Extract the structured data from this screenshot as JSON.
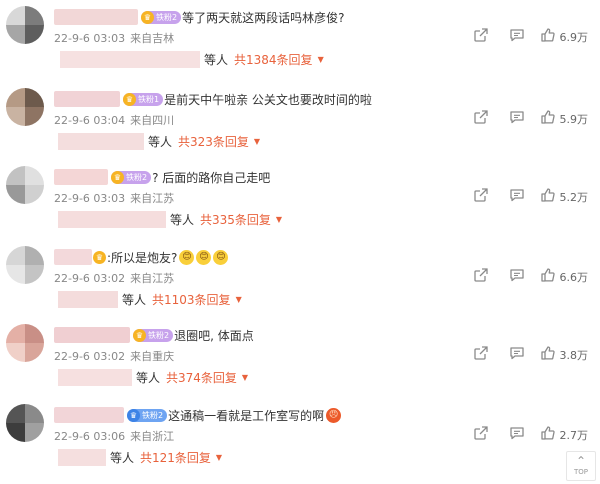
{
  "comments": [
    {
      "badge": {
        "text": "铁粉2",
        "style": "gold"
      },
      "text": "等了两天就这两段话吗林彦俊?",
      "emojis": [],
      "date": "22-9-6 03:03",
      "location": "来自吉林",
      "likes": "6.9万",
      "reply_people": "等人",
      "reply_total": "共1384条回复",
      "avatar_colors": [
        "#d8d8d8",
        "#7c7c7c",
        "#a6a6a6",
        "#5e5e5e"
      ],
      "name_blur_color": "#f2d7d7",
      "reply_blur_color": "#f6e1e1"
    },
    {
      "badge": {
        "text": "铁粉1",
        "style": "gold"
      },
      "text": "是前天中午啦亲 公关文也要改时间的啦",
      "emojis": [],
      "date": "22-9-6 03:04",
      "location": "来自四川",
      "likes": "5.9万",
      "reply_people": "等人",
      "reply_total": "共323条回复",
      "avatar_colors": [
        "#b59a85",
        "#6d5a4c",
        "#c9b3a2",
        "#8e7463"
      ],
      "name_blur_color": "#f1d3d6",
      "reply_blur_color": "#f4dede"
    },
    {
      "badge": {
        "text": "铁粉2",
        "style": "gold"
      },
      "text": "? 后面的路你自己走吧",
      "emojis": [],
      "date": "22-9-6 03:03",
      "location": "来自江苏",
      "likes": "5.2万",
      "reply_people": "等人",
      "reply_total": "共335条回复",
      "avatar_colors": [
        "#c2c2c2",
        "#e0e0e0",
        "#999999",
        "#d0d0d0"
      ],
      "name_blur_color": "#f4d6d6",
      "reply_blur_color": "#f5dddd"
    },
    {
      "badge": {
        "text": "",
        "style": "bare"
      },
      "text": ":所以是炮友?",
      "emojis": [
        "😊",
        "😊",
        "😊"
      ],
      "date": "22-9-6 03:02",
      "location": "来自江苏",
      "likes": "6.6万",
      "reply_people": "等人",
      "reply_total": "共1103条回复",
      "avatar_colors": [
        "#d6d6d6",
        "#b0b0b0",
        "#e6e6e6",
        "#c4c4c4"
      ],
      "name_blur_color": "#f3d9db",
      "reply_blur_color": "#f4dcdc"
    },
    {
      "badge": {
        "text": "铁粉2",
        "style": "gold"
      },
      "text": "退圈吧, 体面点",
      "emojis": [],
      "date": "22-9-6 03:02",
      "location": "来自重庆",
      "likes": "3.8万",
      "reply_people": "等人",
      "reply_total": "共374条回复",
      "avatar_colors": [
        "#e4b0a6",
        "#c98f86",
        "#f0d0c8",
        "#d9a59a"
      ],
      "name_blur_color": "#f0cfd2",
      "reply_blur_color": "#f6e0e0"
    },
    {
      "badge": {
        "text": "铁粉2",
        "style": "blue"
      },
      "text": "这通稿一看就是工作室写的啊",
      "emojis": [
        "😠"
      ],
      "date": "22-9-6 03:06",
      "location": "来自浙江",
      "likes": "2.7万",
      "reply_people": "等人",
      "reply_total": "共121条回复",
      "avatar_colors": [
        "#555555",
        "#8a8a8a",
        "#3d3d3d",
        "#a0a0a0"
      ],
      "name_blur_color": "#f2d5d8",
      "reply_blur_color": "#f5dfdf"
    }
  ],
  "back_to_top": {
    "label": "TOP"
  },
  "icons": {
    "share": "share-icon",
    "comment": "comment-icon",
    "like": "like-icon",
    "caret": "caret-down-icon",
    "top": "arrow-up-icon"
  },
  "colors": {
    "accent": "#e8623c",
    "meta": "#888888",
    "text": "#333333"
  }
}
